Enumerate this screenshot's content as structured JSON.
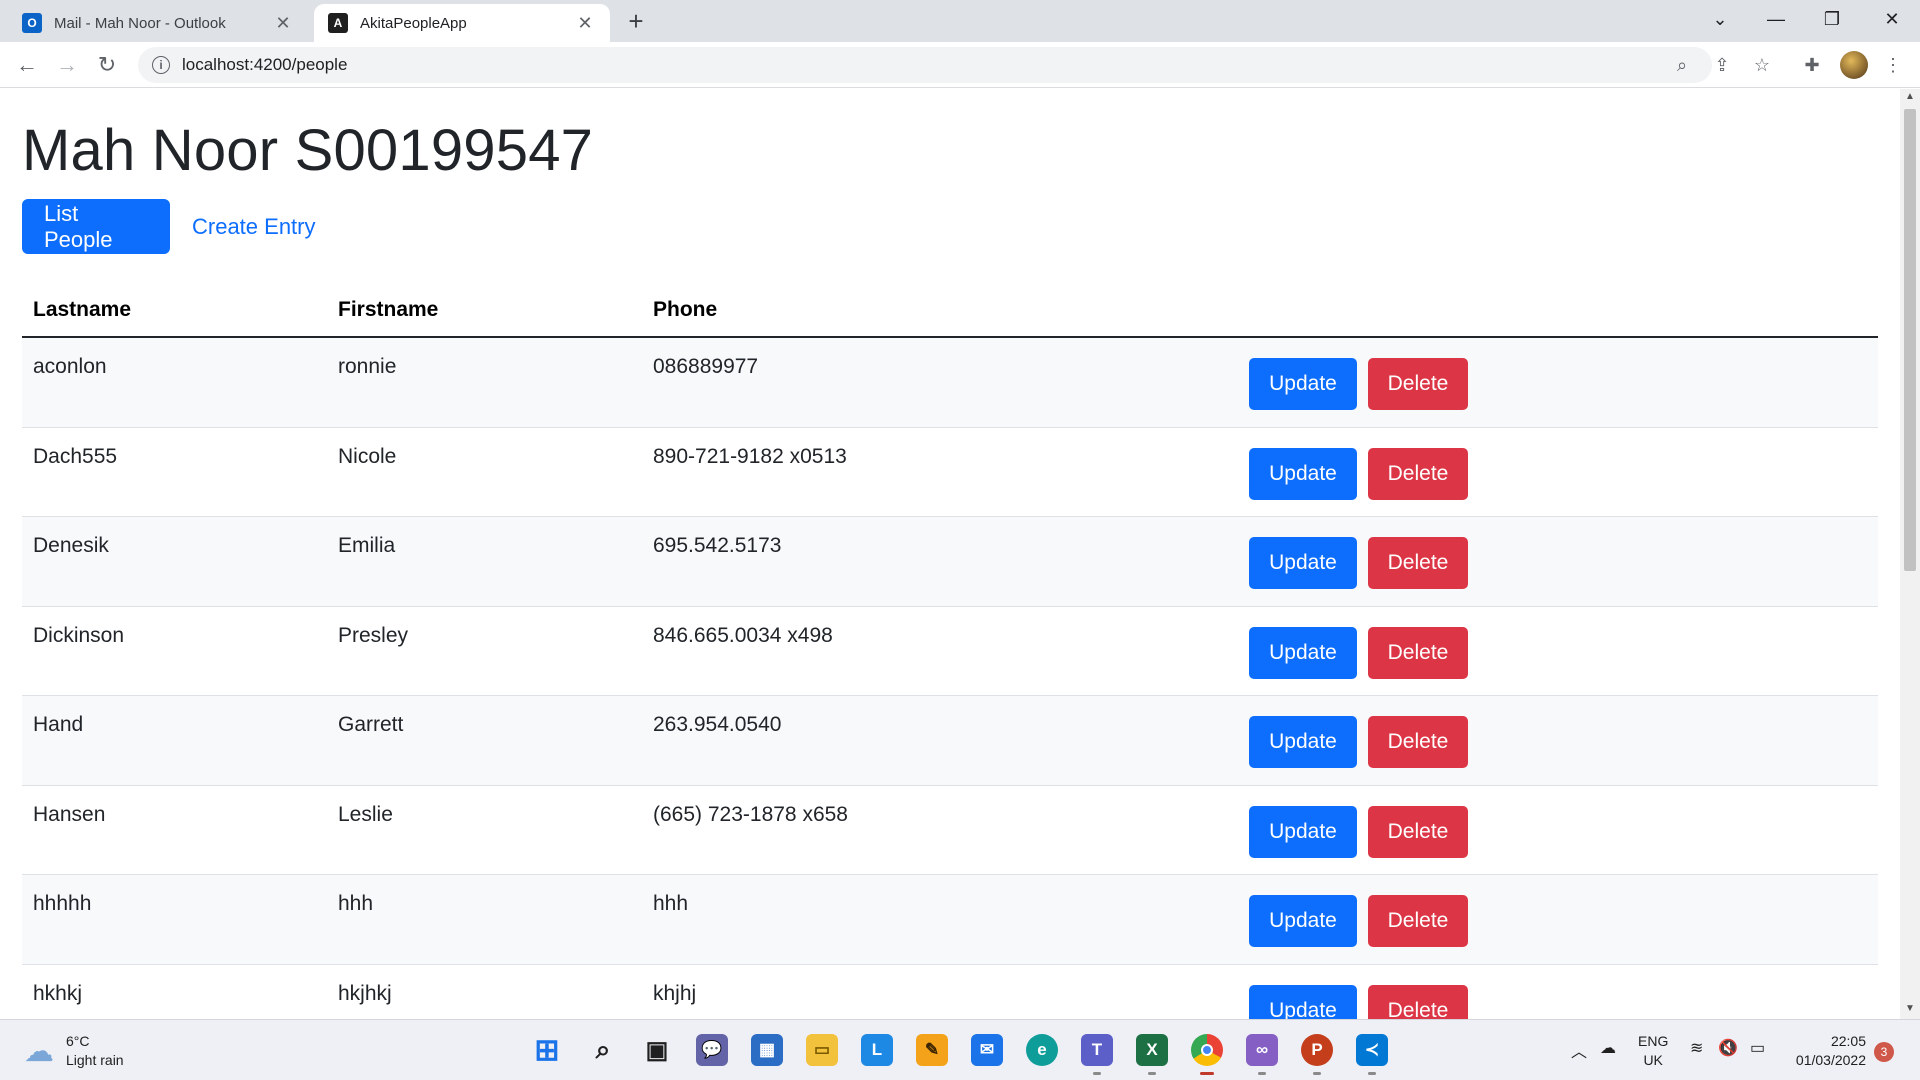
{
  "browser": {
    "tabs": [
      {
        "title": "Mail - Mah Noor - Outlook",
        "icon": "outlook-icon"
      },
      {
        "title": "AkitaPeopleApp",
        "icon": "angular-icon"
      }
    ],
    "url": "localhost:4200/people"
  },
  "page": {
    "title": "Mah Noor S00199547",
    "nav": {
      "list_people": "List People",
      "create_entry": "Create Entry"
    },
    "table": {
      "headers": {
        "lastname": "Lastname",
        "firstname": "Firstname",
        "phone": "Phone"
      },
      "rows": [
        {
          "lastname": "aconlon",
          "firstname": "ronnie",
          "phone": "086889977"
        },
        {
          "lastname": "Dach555",
          "firstname": "Nicole",
          "phone": "890-721-9182 x0513"
        },
        {
          "lastname": "Denesik",
          "firstname": "Emilia",
          "phone": "695.542.5173"
        },
        {
          "lastname": "Dickinson",
          "firstname": "Presley",
          "phone": "846.665.0034 x498"
        },
        {
          "lastname": "Hand",
          "firstname": "Garrett",
          "phone": "263.954.0540"
        },
        {
          "lastname": "Hansen",
          "firstname": "Leslie",
          "phone": "(665) 723-1878 x658"
        },
        {
          "lastname": "hhhhh",
          "firstname": "hhh",
          "phone": "hhh"
        },
        {
          "lastname": "hkhkj",
          "firstname": "hkjhkj",
          "phone": "khjhj"
        }
      ],
      "update_label": "Update",
      "delete_label": "Delete"
    }
  },
  "taskbar": {
    "weather": {
      "temp": "6°C",
      "condition": "Light rain"
    },
    "language": {
      "code": "ENG",
      "region": "UK"
    },
    "clock": {
      "time": "22:05",
      "date": "01/03/2022"
    },
    "notifications": "3"
  },
  "colors": {
    "primary": "#0d6efd",
    "danger": "#dc3545"
  }
}
